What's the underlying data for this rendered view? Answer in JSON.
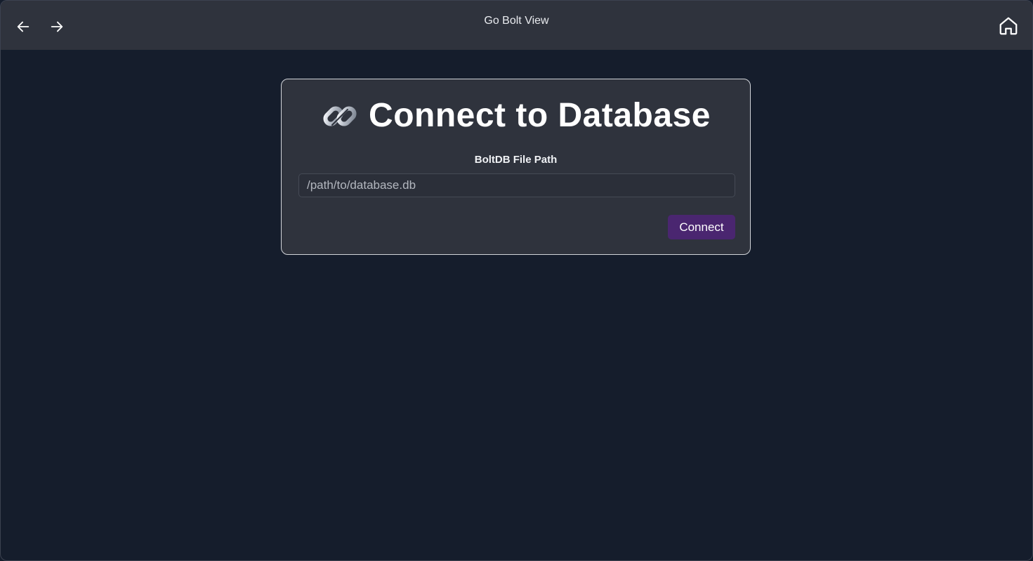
{
  "window": {
    "title": "Go Bolt View"
  },
  "toolbar": {
    "back_icon": "arrow-left-icon",
    "forward_icon": "arrow-right-icon",
    "home_icon": "home-icon"
  },
  "connect_card": {
    "title_icon": "link-icon",
    "title": "Connect to Database",
    "path_label": "BoltDB File Path",
    "path_input": {
      "value": "",
      "placeholder": "/path/to/database.db"
    },
    "connect_button_label": "Connect"
  },
  "colors": {
    "background": "#151d2c",
    "titlebar": "#2f333d",
    "card": "#2f333d",
    "card_border": "#d2d5da",
    "button": "#4a2670",
    "text": "#ffffff"
  }
}
